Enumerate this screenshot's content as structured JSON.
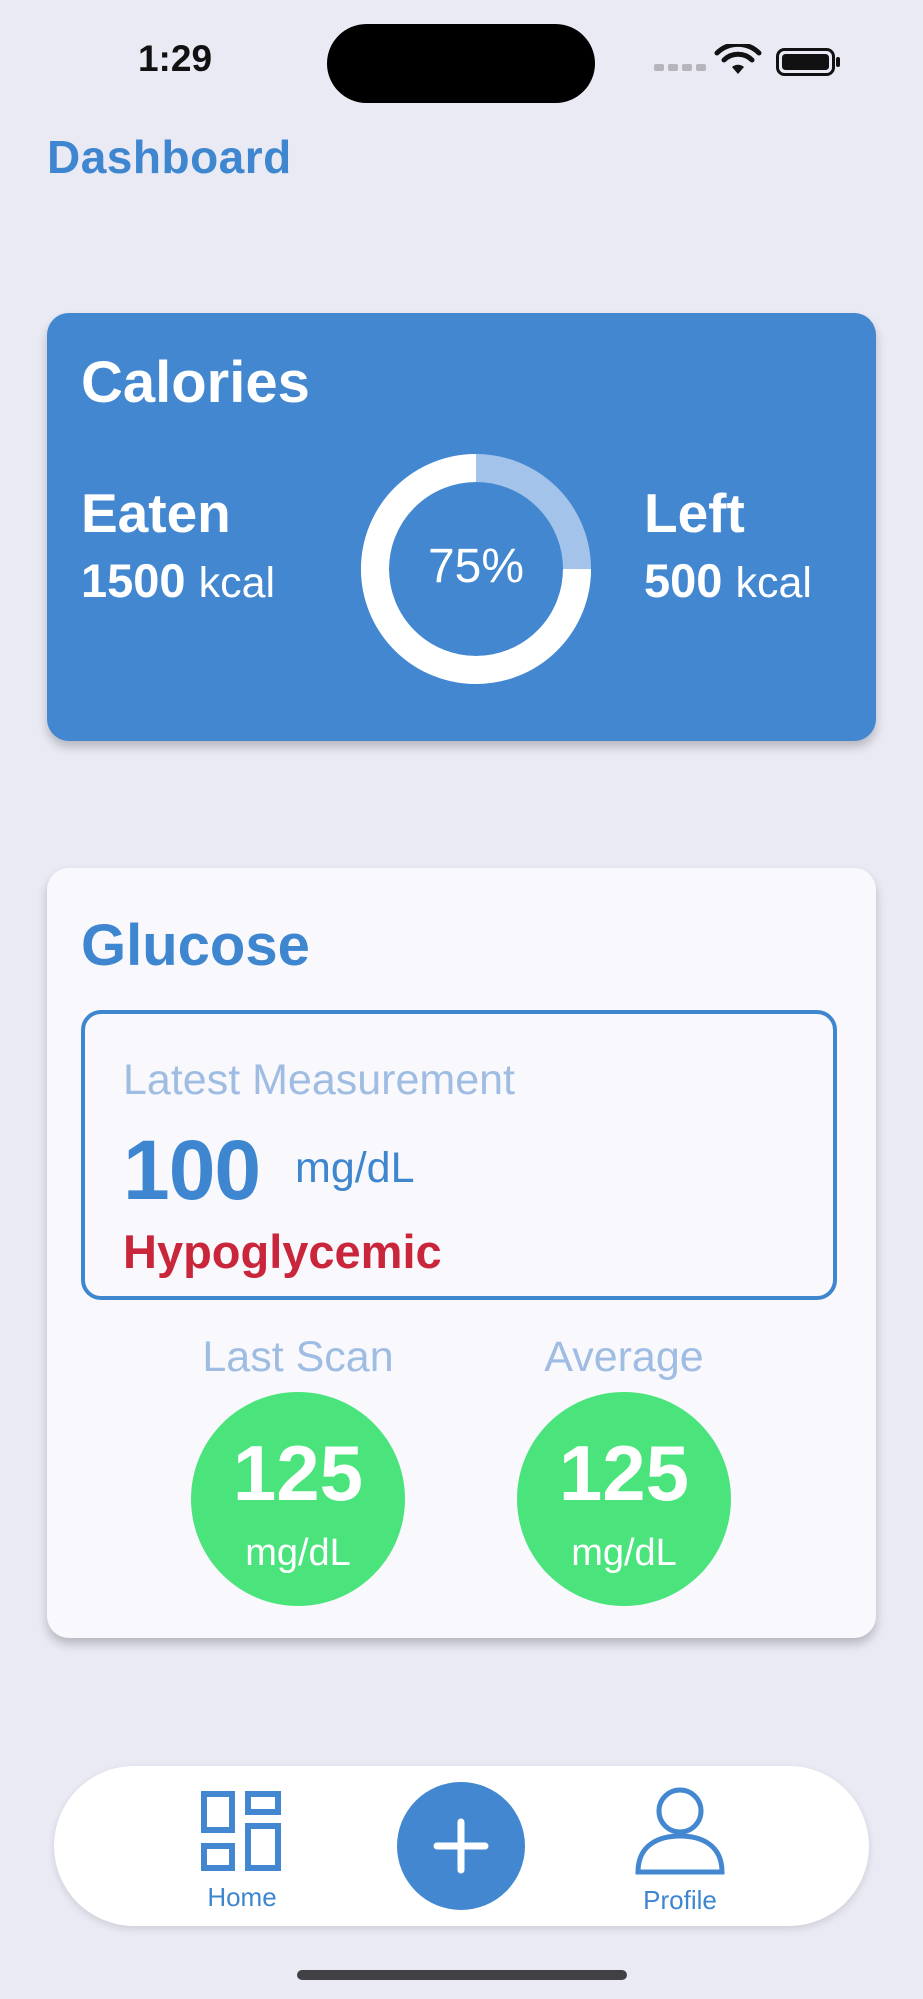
{
  "status_bar": {
    "time": "1:29",
    "signal_icon": "cellular-dots-icon",
    "wifi_icon": "wifi-icon",
    "battery_icon": "battery-icon"
  },
  "header": {
    "title": "Dashboard"
  },
  "calories": {
    "title": "Calories",
    "eaten_label": "Eaten",
    "eaten_value": "1500",
    "eaten_unit": "kcal",
    "left_label": "Left",
    "left_value": "500",
    "left_unit": "kcal",
    "progress_text": "75%",
    "progress_fraction": 0.75
  },
  "glucose": {
    "title": "Glucose",
    "latest_label": "Latest Measurement",
    "latest_value": "100",
    "latest_unit": "mg/dL",
    "latest_status": "Hypoglycemic",
    "last_scan_label": "Last Scan",
    "last_scan_value": "125",
    "last_scan_unit": "mg/dL",
    "average_label": "Average",
    "average_value": "125",
    "average_unit": "mg/dL"
  },
  "tabbar": {
    "home_label": "Home",
    "home_icon": "grid-icon",
    "add_icon": "plus-icon",
    "profile_label": "Profile",
    "profile_icon": "person-icon"
  },
  "colors": {
    "accent": "#4287d0",
    "background": "#e9eaf4",
    "status_alert": "#c9253b",
    "stat_green": "#4be47c"
  }
}
